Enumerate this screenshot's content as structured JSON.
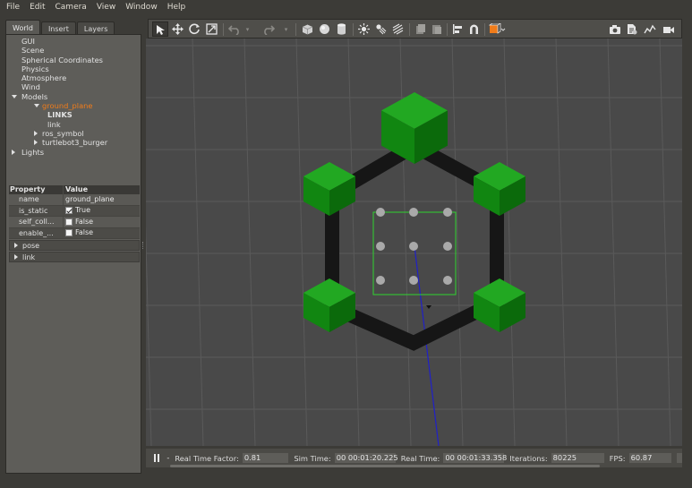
{
  "menubar": {
    "items": [
      "File",
      "Edit",
      "Camera",
      "View",
      "Window",
      "Help"
    ]
  },
  "left_panel": {
    "tabs": [
      {
        "label": "World",
        "active": true
      },
      {
        "label": "Insert",
        "active": false
      },
      {
        "label": "Layers",
        "active": false
      }
    ],
    "tree": [
      {
        "label": "GUI",
        "indent": 1,
        "arrow": "none"
      },
      {
        "label": "Scene",
        "indent": 1,
        "arrow": "none"
      },
      {
        "label": "Spherical Coordinates",
        "indent": 1,
        "arrow": "none"
      },
      {
        "label": "Physics",
        "indent": 1,
        "arrow": "none"
      },
      {
        "label": "Atmosphere",
        "indent": 1,
        "arrow": "none"
      },
      {
        "label": "Wind",
        "indent": 1,
        "arrow": "none"
      },
      {
        "label": "Models",
        "indent": 0,
        "arrow": "down"
      },
      {
        "label": "ground_plane",
        "indent": 2,
        "arrow": "down",
        "selected": true
      },
      {
        "label": "LINKS",
        "indent": 3,
        "arrow": "none",
        "bold": true
      },
      {
        "label": "link",
        "indent": 3,
        "arrow": "none"
      },
      {
        "label": "ros_symbol",
        "indent": 2,
        "arrow": "right"
      },
      {
        "label": "turtlebot3_burger",
        "indent": 2,
        "arrow": "right"
      },
      {
        "label": "Lights",
        "indent": 0,
        "arrow": "right"
      }
    ],
    "property_table": {
      "header": {
        "property": "Property",
        "value": "Value"
      },
      "rows": [
        {
          "name": "name",
          "value": "ground_plane",
          "checkbox": null
        },
        {
          "name": "is_static",
          "value": "True",
          "checkbox": true
        },
        {
          "name": "self_coll...",
          "value": "False",
          "checkbox": false
        },
        {
          "name": "enable_...",
          "value": "False",
          "checkbox": false
        }
      ],
      "groups": [
        "pose",
        "link"
      ]
    }
  },
  "toolbar": {
    "left_tools": [
      "select-mode",
      "translate-mode",
      "rotate-mode",
      "scale-mode",
      "undo",
      "undo-history",
      "redo",
      "redo-history",
      "box-shape",
      "sphere-shape",
      "cylinder-shape",
      "point-light",
      "spot-light",
      "directional-light",
      "copy",
      "paste",
      "align",
      "snap",
      "change-view"
    ],
    "right_tools": [
      "screenshot",
      "log-data",
      "plot",
      "video-record"
    ]
  },
  "viewport": {
    "colors": {
      "background": "#494949",
      "grid": "#5a5a5a",
      "cube_front": "#118611",
      "cube_top": "#22a822",
      "cube_side": "#0b6a0b",
      "link": "#171717",
      "selection": "#2ed42e",
      "axis": "#2020c8"
    }
  },
  "bottombar": {
    "step_label": "-",
    "real_time_factor_label": "Real Time Factor:",
    "real_time_factor": "0.81",
    "sim_time_label": "Sim Time:",
    "sim_time": "00 00:01:20.225",
    "real_time_label": "Real Time:",
    "real_time": "00 00:01:33.358",
    "iterations_label": "Iterations:",
    "iterations": "80225",
    "fps_label": "FPS:",
    "fps": "60.87"
  }
}
